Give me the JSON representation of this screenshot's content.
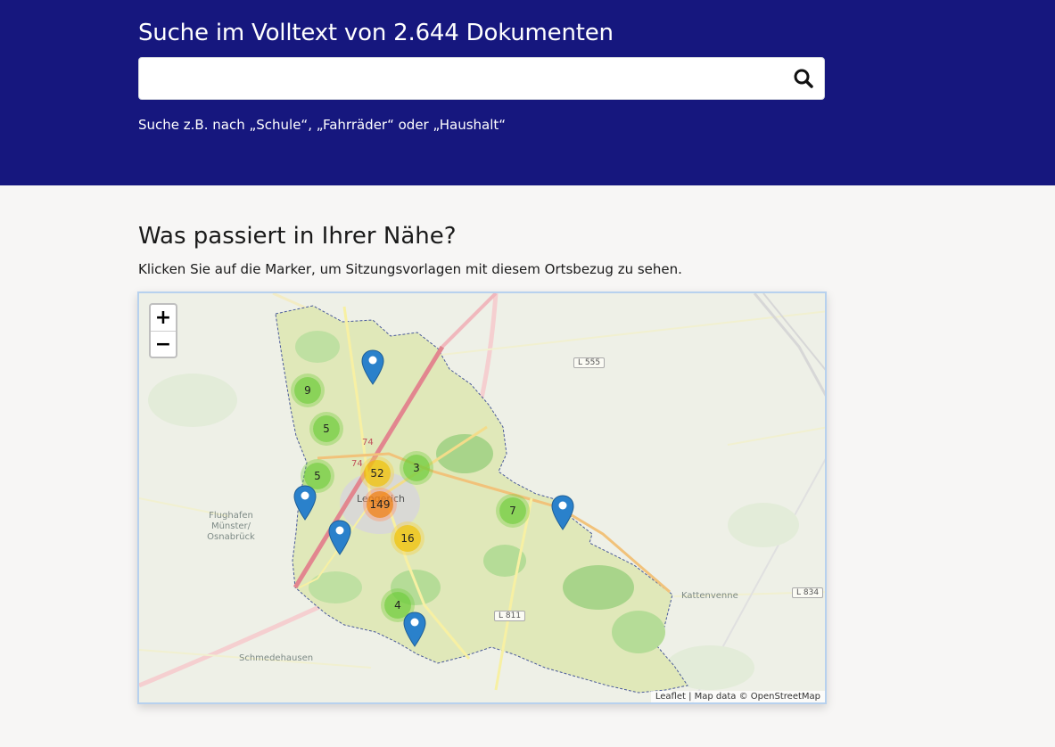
{
  "header": {
    "title": "Suche im Volltext von 2.644 Dokumenten",
    "search_placeholder": "",
    "search_value": "",
    "search_icon": "search-icon",
    "hint": "Suche z.B. nach „Schule“, „Fahrräder“ oder „Haushalt“"
  },
  "nearby": {
    "title": "Was passiert in Ihrer Nähe?",
    "description": "Klicken Sie auf die Marker, um Sitzungsvorlagen mit diesem Ortsbezug zu sehen."
  },
  "map": {
    "zoom_in": "+",
    "zoom_out": "−",
    "clusters": [
      "9",
      "5",
      "5",
      "52",
      "3",
      "149",
      "7",
      "16",
      "4"
    ],
    "place_labels": {
      "town": "Lengerich",
      "airport": "Flughafen\nMünster/\nOsnabrück",
      "kattenvenne": "Kattenvenne",
      "schmedehausen": "Schmedehausen"
    },
    "road_labels": {
      "l555": "L 555",
      "l811": "L 811",
      "l834": "L 834",
      "a74a": "74",
      "a74b": "74"
    },
    "attribution": {
      "leaflet": "Leaflet",
      "separator": " | Map data © ",
      "osm": "OpenStreetMap"
    },
    "colors": {
      "district_fill": "#dfe8b8",
      "forest": "#a8d48a",
      "highway": "#e2868f",
      "cluster_small": "#6ecc39",
      "cluster_medium": "#f0c20c",
      "cluster_large": "#f18017",
      "marker": "#2a81cb"
    }
  }
}
